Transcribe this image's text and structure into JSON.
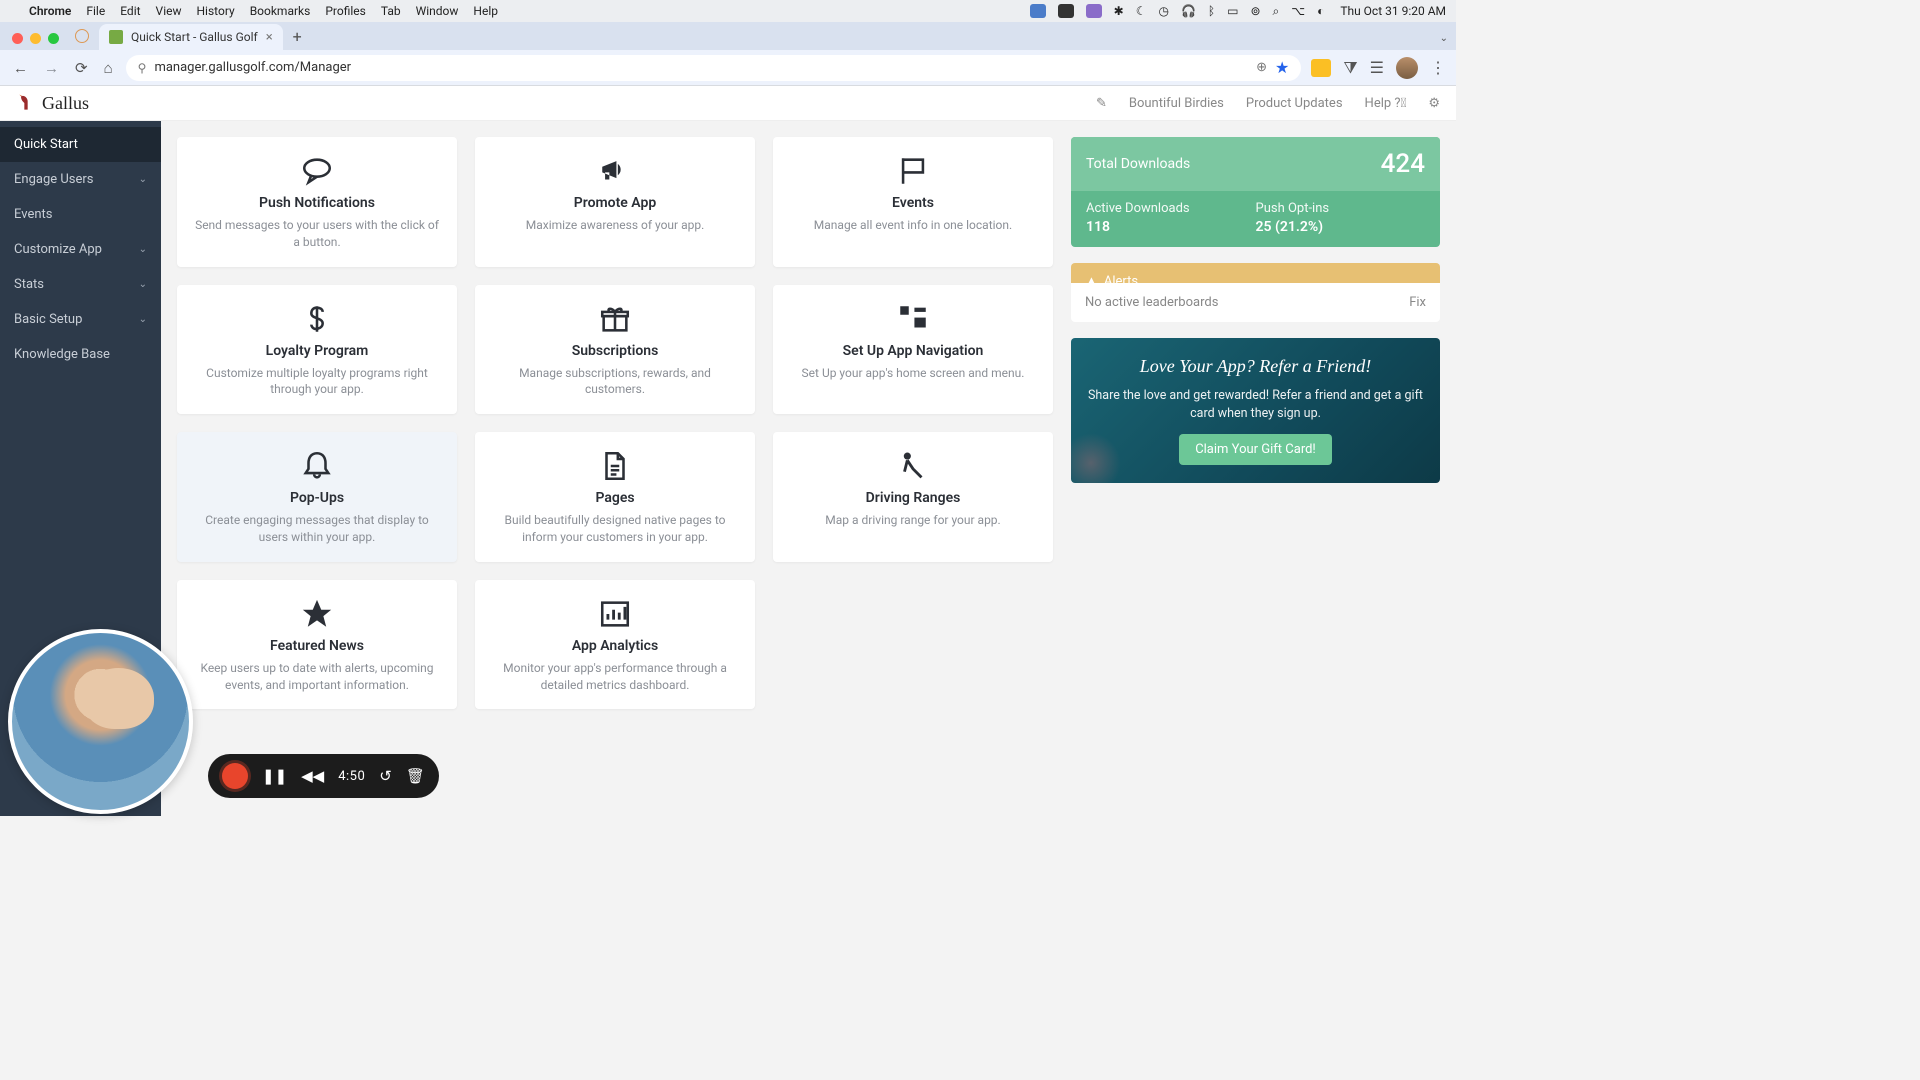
{
  "menubar": {
    "app": "Chrome",
    "items": [
      "File",
      "Edit",
      "View",
      "History",
      "Bookmarks",
      "Profiles",
      "Tab",
      "Window",
      "Help"
    ],
    "clock": "Thu Oct 31  9:20 AM"
  },
  "browser": {
    "tab_title": "Quick Start - Gallus Golf",
    "url": "manager.gallusgolf.com/Manager"
  },
  "header": {
    "brand": "Gallus",
    "links": {
      "org": "Bountiful Birdies",
      "updates": "Product Updates",
      "help": "Help"
    }
  },
  "sidebar": {
    "items": [
      {
        "label": "Quick Start",
        "expandable": false,
        "active": true
      },
      {
        "label": "Engage Users",
        "expandable": true,
        "active": false
      },
      {
        "label": "Events",
        "expandable": false,
        "active": false
      },
      {
        "label": "Customize App",
        "expandable": true,
        "active": false
      },
      {
        "label": "Stats",
        "expandable": true,
        "active": false
      },
      {
        "label": "Basic Setup",
        "expandable": true,
        "active": false
      },
      {
        "label": "Knowledge Base",
        "expandable": false,
        "active": false
      }
    ]
  },
  "cards": [
    {
      "icon": "comment",
      "title": "Push Notifications",
      "desc": "Send messages to your users with the click of a button."
    },
    {
      "icon": "megaphone",
      "title": "Promote App",
      "desc": "Maximize awareness of your app."
    },
    {
      "icon": "flag",
      "title": "Events",
      "desc": "Manage all event info in one location."
    },
    {
      "icon": "dollar",
      "title": "Loyalty Program",
      "desc": "Customize multiple loyalty programs right through your app."
    },
    {
      "icon": "gift",
      "title": "Subscriptions",
      "desc": "Manage subscriptions, rewards, and customers."
    },
    {
      "icon": "sitemap",
      "title": "Set Up App Navigation",
      "desc": "Set Up your app's home screen and menu."
    },
    {
      "icon": "bell",
      "title": "Pop-Ups",
      "desc": "Create engaging messages that display to users within your app.",
      "hover": true
    },
    {
      "icon": "file",
      "title": "Pages",
      "desc": "Build beautifully designed native pages to inform your customers in your app."
    },
    {
      "icon": "golfer",
      "title": "Driving Ranges",
      "desc": "Map a driving range for your app."
    },
    {
      "icon": "star",
      "title": "Featured News",
      "desc": "Keep users up to date with alerts, upcoming events, and important information."
    },
    {
      "icon": "chart",
      "title": "App Analytics",
      "desc": "Monitor your app's performance through a detailed metrics dashboard."
    }
  ],
  "stats": {
    "total_label": "Total Downloads",
    "total_value": "424",
    "active_label": "Active Downloads",
    "active_value": "118",
    "push_label": "Push Opt-ins",
    "push_value": "25 (21.2%)"
  },
  "alerts": {
    "title": "Alerts",
    "message": "No active leaderboards",
    "action": "Fix"
  },
  "refer": {
    "title": "Love Your App? Refer a Friend!",
    "sub": "Share the love and get rewarded! Refer a friend and get a gift card when they sign up.",
    "button": "Claim Your Gift Card!"
  },
  "recorder": {
    "time": "4:50"
  }
}
